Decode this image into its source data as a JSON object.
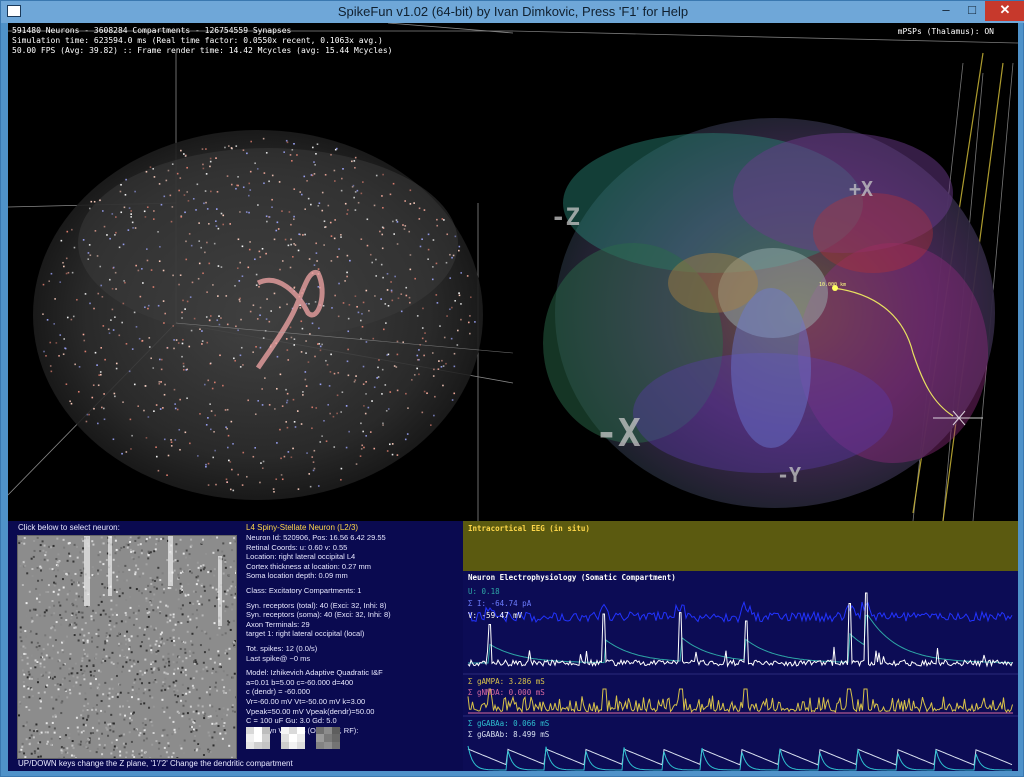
{
  "window": {
    "title": "SpikeFun v1.02 (64-bit) by Ivan Dimkovic, Press 'F1' for Help",
    "minimize_glyph": "–",
    "maximize_glyph": "□",
    "close_glyph": "✕"
  },
  "left_view": {
    "stats_line1": "591480 Neurons - 3608284 Compartments - 126754559 Synapses",
    "stats_line2": "Simulation time: 623594.0 ms (Real time factor: 0.0550x recent, 0.1063x avg.)",
    "stats_line3": "50.00 FPS (Avg: 39.82) :: Frame render time: 14.42 Mcycles (avg: 15.44 Mcycles)"
  },
  "right_view": {
    "mpsps": "mPSPs (Thalamus): ON",
    "axis_labels": [
      "-Z",
      "+X",
      "-X",
      "-Y"
    ],
    "marker_label": "10.000 km"
  },
  "neuron_selector": {
    "hint": "Click below to select neuron:",
    "keys_hint": "UP/DOWN keys change the Z plane, '1'/'2' Change the dendritic compartment"
  },
  "neuron_info": {
    "title": "L4 Spiny-Stellate Neuron (L2/3)",
    "group1": [
      "Neuron Id: 520906,  Pos: 16.56 6.42 29.55",
      "Retinal Coords: u: 0.60 v: 0.55",
      "Location: right lateral occipital L4",
      "Cortex thickness at location: 0.27 mm",
      "Soma location depth: 0.09 mm"
    ],
    "group2": [
      "Class: Excitatory   Compartments: 1"
    ],
    "group3": [
      "Syn. receptors (total): 40 (Exci: 32, Inhi: 8)",
      "Syn. receptors (soma): 40 (Exci: 32, Inhi: 8)",
      "Axon Terminals: 29",
      "   target 1: right lateral occipital (local)"
    ],
    "group4": [
      "Tot. spikes: 12 (0.0/s)",
      "Last spike@ ~0 ms"
    ],
    "group5": [
      "Model: Izhikevich Adaptive Quadratic I&F",
      "a=0.01  b=5.00  c=-60.000  d=400",
      "c (dendr) = -60.000",
      "Vr=-60.00 mV  Vt=-50.00 mV  k=3.00",
      "Vpeak=50.00 mV  Vpeak(dendr)=50.00",
      "C = 100 uF  Gu: 3.0  Gd: 5.0",
      "LGN Syn Weights (ON, OFF, RF):"
    ],
    "weight_grids": [
      [
        "#d8d8d8",
        "#ffffff",
        "#bdbdbd",
        "#f0f0f0",
        "#ffffff",
        "#cfcfcf",
        "#e6e6e6",
        "#d0d0d0",
        "#c4c4c4"
      ],
      [
        "#f5f5f5",
        "#dadada",
        "#ffffff",
        "#e0e0e0",
        "#ffffff",
        "#ececec",
        "#cdcdcd",
        "#f2f2f2",
        "#dddddd"
      ],
      [
        "#707070",
        "#8c8c8c",
        "#5e5e5e",
        "#9a9a9a",
        "#7a7a7a",
        "#686868",
        "#838383",
        "#909090",
        "#747474"
      ]
    ]
  },
  "eeg": {
    "title": "Intracortical EEG (in situ)"
  },
  "ephys": {
    "title": "Neuron Electrophysiology (Somatic Compartment)",
    "u_label": "U: 0.18",
    "i_label": "Σ I: -64.74 pA",
    "v_label": "V: -59.47 mV",
    "gampa_label": "Σ gAMPA: 3.286 mS",
    "gnmda_label": "Σ gNMDA: 0.000 mS",
    "ggabaa_label": "Σ gGABAa: 0.066 mS",
    "ggabab_label": "Σ gGABAb: 8.499 mS",
    "colors": {
      "u": "#2ea6a6",
      "i": "#2233ff",
      "v": "#ffffff",
      "gampa": "#d8c24a",
      "gnmda": "#d86aa0",
      "ggabaa": "#2ec0d0",
      "ggabab": "#d8e0f0"
    },
    "spike_positions": [
      0.04,
      0.25,
      0.39,
      0.51,
      0.7,
      0.73
    ],
    "spike_heights": [
      0.55,
      0.7,
      0.72,
      0.6,
      0.85,
      1.0
    ]
  }
}
